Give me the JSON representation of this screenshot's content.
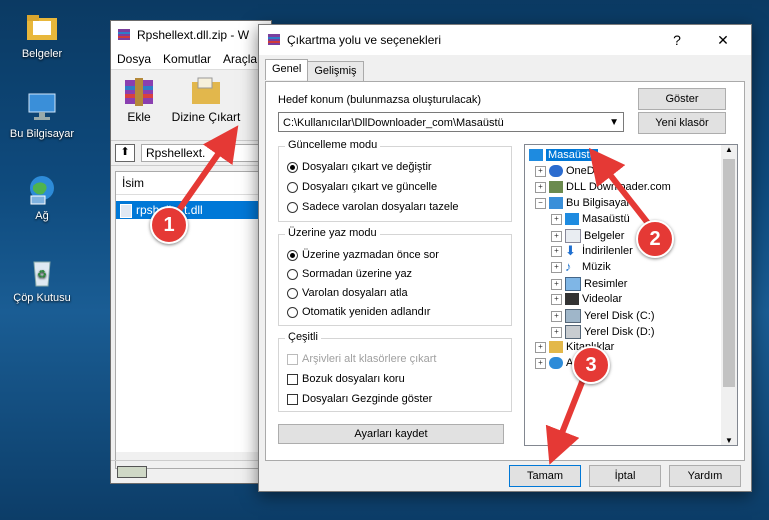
{
  "desktop": {
    "icons": [
      {
        "label": "Belgeler"
      },
      {
        "label": "Bu Bilgisayar"
      },
      {
        "label": "Ağ"
      },
      {
        "label": "Çöp Kutusu"
      }
    ]
  },
  "rar_window": {
    "title": "Rpshellext.dll.zip - W",
    "menu": [
      "Dosya",
      "Komutlar",
      "Araçla"
    ],
    "toolbar": {
      "add_label": "Ekle",
      "extract_label": "Dizine Çıkart"
    },
    "address": "Rpshellext.",
    "column_name": "İsim",
    "file_row": "rpshellext.dll"
  },
  "dialog": {
    "title": "Çıkartma yolu ve seçenekleri",
    "help_glyph": "?",
    "close_glyph": "✕",
    "tabs": [
      "Genel",
      "Gelişmiş"
    ],
    "dest_label": "Hedef konum (bulunmazsa oluşturulacak)",
    "dest_value": "C:\\Kullanıcılar\\DllDownloader_com\\Masaüstü",
    "show_button": "Göster",
    "new_folder_button": "Yeni klasör",
    "update_mode": {
      "title": "Güncelleme modu",
      "options": [
        "Dosyaları çıkart ve değiştir",
        "Dosyaları çıkart ve güncelle",
        "Sadece varolan dosyaları tazele"
      ],
      "selected": 0
    },
    "overwrite_mode": {
      "title": "Üzerine yaz modu",
      "options": [
        "Üzerine yazmadan önce sor",
        "Sormadan üzerine yaz",
        "Varolan dosyaları atla",
        "Otomatik yeniden adlandır"
      ],
      "selected": 0
    },
    "misc": {
      "title": "Çeşitli",
      "options": [
        "Arşivleri alt klasörlere çıkart",
        "Bozuk dosyaları koru",
        "Dosyaları Gezginde göster"
      ]
    },
    "save_settings_button": "Ayarları kaydet",
    "tree": {
      "selected": "Masaüstü",
      "items": [
        "Masaüstü",
        "OneDrive",
        "DLL Downloader.com",
        "Bu Bilgisayar",
        "Masaüstü",
        "Belgeler",
        "İndirilenler",
        "Müzik",
        "Resimler",
        "Videolar",
        "Yerel Disk (C:)",
        "Yerel Disk (D:)",
        "Kitaplıklar",
        "Ağ"
      ]
    },
    "ok_button": "Tamam",
    "cancel_button": "İptal",
    "help_button": "Yardım"
  },
  "annotations": {
    "step1": "1",
    "step2": "2",
    "step3": "3"
  },
  "colors": {
    "selection": "#0078d7",
    "arrow": "#e53935"
  }
}
